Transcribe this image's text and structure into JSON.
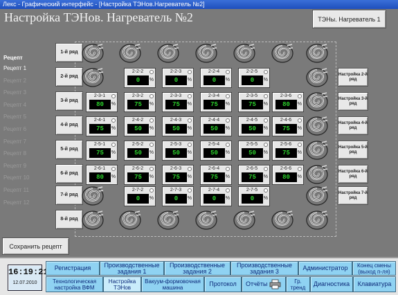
{
  "window_title": "Лекс - Графический интерфейс - [Настройка ТЭНов.Нагреватель №2]",
  "page_title": "Настройка ТЭНов. Нагреватель №2",
  "heater_button": "ТЭНы. Нагреватель 1",
  "recipes": {
    "title": "Рецепт",
    "items": [
      "Рецепт 1",
      "Рецепт 2",
      "Рецепт 3",
      "Рецепт 4",
      "Рецепт 5",
      "Рецепт 6",
      "Рецепт 7",
      "Рецепт 8",
      "Рецепт 9",
      "Рецепт 10",
      "Рецепт 11",
      "Рецепт 12"
    ],
    "active_index": 0
  },
  "row_buttons": [
    "1-й ряд",
    "2-й ряд",
    "3-й ряд",
    "4-й ряд",
    "5-й ряд",
    "6-й ряд",
    "7-й ряд",
    "8-й ряд"
  ],
  "setup_buttons": [
    "Настройка 2-й ряд",
    "Настройка 3-й ряд",
    "Настройка 4-й ряд",
    "Настройка 5-й ряд",
    "Настройка 6-й ряд",
    "Настройка 7-й ряд"
  ],
  "percent_unit": "%",
  "cell_rows": [
    {
      "cells": [
        {
          "label": "2-2-2",
          "value": "0"
        },
        {
          "label": "2-2-3",
          "value": "0"
        },
        {
          "label": "2-2-4",
          "value": "0"
        },
        {
          "label": "2-2-5",
          "value": "0"
        }
      ]
    },
    {
      "cells": [
        {
          "label": "2-3-1",
          "value": "80"
        },
        {
          "label": "2-3-2",
          "value": "75"
        },
        {
          "label": "2-3-3",
          "value": "75"
        },
        {
          "label": "2-3-4",
          "value": "75"
        },
        {
          "label": "2-3-5",
          "value": "75"
        },
        {
          "label": "2-3-6",
          "value": "80"
        }
      ]
    },
    {
      "cells": [
        {
          "label": "2-4-1",
          "value": "75"
        },
        {
          "label": "2-4-2",
          "value": "50"
        },
        {
          "label": "2-4-3",
          "value": "50"
        },
        {
          "label": "2-4-4",
          "value": "50"
        },
        {
          "label": "2-4-5",
          "value": "50"
        },
        {
          "label": "2-4-6",
          "value": "75"
        }
      ]
    },
    {
      "cells": [
        {
          "label": "2-5-1",
          "value": "75"
        },
        {
          "label": "2-5-2",
          "value": "50"
        },
        {
          "label": "2-5-3",
          "value": "50"
        },
        {
          "label": "2-5-4",
          "value": "50"
        },
        {
          "label": "2-5-5",
          "value": "50"
        },
        {
          "label": "2-5-6",
          "value": "75"
        }
      ]
    },
    {
      "cells": [
        {
          "label": "2-6-1",
          "value": "80"
        },
        {
          "label": "2-6-2",
          "value": "75"
        },
        {
          "label": "2-6-3",
          "value": "75"
        },
        {
          "label": "2-6-4",
          "value": "75"
        },
        {
          "label": "2-6-5",
          "value": "75"
        },
        {
          "label": "2-6-6",
          "value": "80"
        }
      ]
    },
    {
      "cells": [
        {
          "label": "2-7-2",
          "value": "0"
        },
        {
          "label": "2-7-3",
          "value": "0"
        },
        {
          "label": "2-7-4",
          "value": "0"
        },
        {
          "label": "2-7-5",
          "value": "0"
        }
      ]
    }
  ],
  "save_button": "Сохранить рецепт",
  "clock": {
    "time": "16:19:21",
    "date": "12.07.2010"
  },
  "nav": {
    "registration": "Регистрация",
    "prod1": "Производственные задания 1",
    "prod2": "Производственные задания 2",
    "prod3": "Производственные задания 3",
    "admin": "Администратор",
    "shift_end": "Конец смены (выход п-ля)",
    "tech_setup": "Технологическая настройка ВФМ",
    "ten_setup": "Настройка ТЭНов",
    "vacuum": "Вакуум-формовочная машина",
    "protocol": "Протокол",
    "reports": "Отчёты",
    "graph": "Гр. тренд",
    "diagnostics": "Диагностика",
    "keyboard": "Клавиатура"
  },
  "icons": {
    "heater": "heater-coil-icon",
    "indicator": "status-indicator-icon",
    "printer": "printer-icon"
  }
}
